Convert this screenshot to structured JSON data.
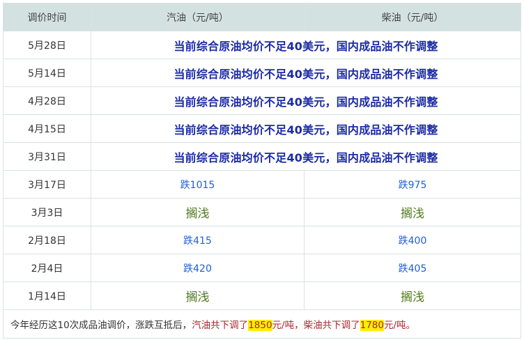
{
  "headers": {
    "date": "调价时间",
    "gasoline": "汽油（元/吨）",
    "diesel": "柴油（元/吨）"
  },
  "notice_rows": [
    {
      "date": "5月28日",
      "note": "当前综合原油均价不足40美元，国内成品油不作调整"
    },
    {
      "date": "5月14日",
      "note": "当前综合原油均价不足40美元，国内成品油不作调整"
    },
    {
      "date": "4月28日",
      "note": "当前综合原油均价不足40美元，国内成品油不作调整"
    },
    {
      "date": "4月15日",
      "note": "当前综合原油均价不足40美元，国内成品油不作调整"
    },
    {
      "date": "3月31日",
      "note": "当前综合原油均价不足40美元，国内成品油不作调整"
    }
  ],
  "value_rows": [
    {
      "date": "3月17日",
      "gasoline": "跌1015",
      "diesel": "跌975",
      "kind": "down"
    },
    {
      "date": "3月3日",
      "gasoline": "搁浅",
      "diesel": "搁浅",
      "kind": "flat"
    },
    {
      "date": "2月18日",
      "gasoline": "跌415",
      "diesel": "跌400",
      "kind": "down"
    },
    {
      "date": "2月4日",
      "gasoline": "跌420",
      "diesel": "跌405",
      "kind": "down"
    },
    {
      "date": "1月14日",
      "gasoline": "搁浅",
      "diesel": "搁浅",
      "kind": "flat"
    }
  ],
  "footer": {
    "intro": "今年经历这10次成品油调价，涨跌互抵后，",
    "gas_text": "汽油共下调了",
    "gas_value": "1850",
    "gas_unit": "元/吨，",
    "diesel_text": "柴油共下调了",
    "diesel_value": "1780",
    "diesel_unit": "元/吨。"
  },
  "colors": {
    "header_bg": "#d3e1e1",
    "notice": "#1b2aa6",
    "down": "#1f5fd6",
    "flat": "#4f7a1e",
    "red": "#a8262e",
    "highlight": "#ffee00"
  }
}
